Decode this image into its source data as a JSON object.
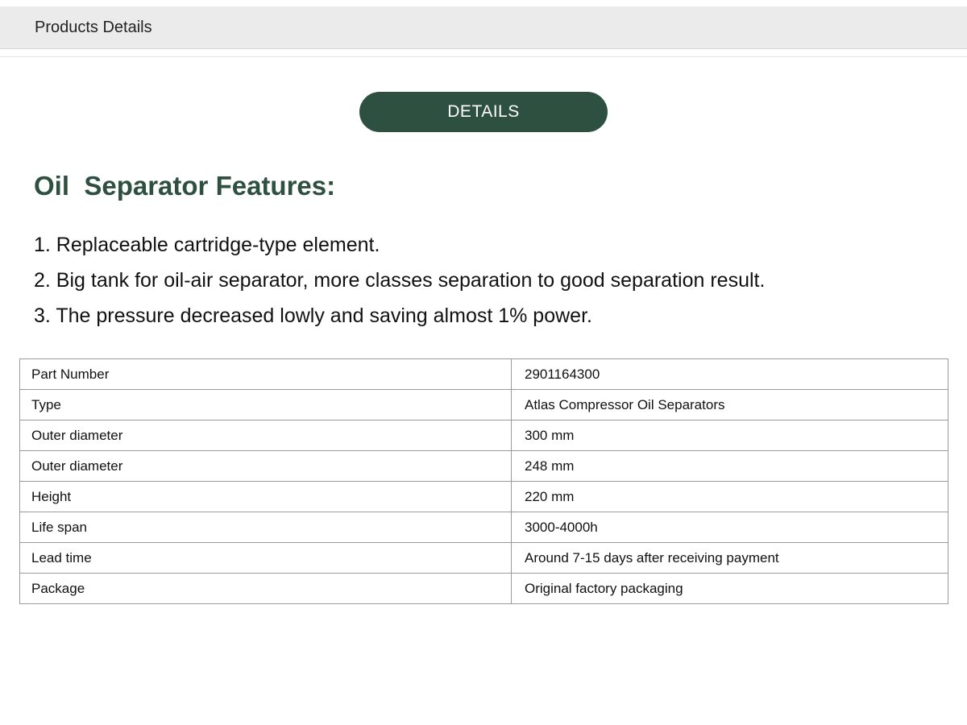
{
  "header": {
    "title": "Products Details"
  },
  "details_button": {
    "label": "DETAILS"
  },
  "features": {
    "heading": "Oil  Separator Features:",
    "items": [
      "1. Replaceable cartridge-type element.",
      "2. Big tank for oil-air separator, more classes separation to good separation result.",
      "3. The pressure decreased lowly and saving almost 1% power."
    ]
  },
  "specs": {
    "rows": [
      {
        "label": "Part Number",
        "value": "2901164300"
      },
      {
        "label": "Type",
        "value": "Atlas Compressor Oil Separators"
      },
      {
        "label": "Outer diameter",
        "value": "300 mm"
      },
      {
        "label": "Outer diameter",
        "value": "248 mm"
      },
      {
        "label": "Height",
        "value": "220 mm"
      },
      {
        "label": "Life span",
        "value": "3000-4000h"
      },
      {
        "label": "Lead time",
        "value": "Around 7-15 days after receiving payment"
      },
      {
        "label": "Package",
        "value": "Original factory packaging"
      }
    ]
  },
  "colors": {
    "accent_green": "#2e5040",
    "header_background": "#ebebeb",
    "table_border": "#9a9a9a"
  }
}
